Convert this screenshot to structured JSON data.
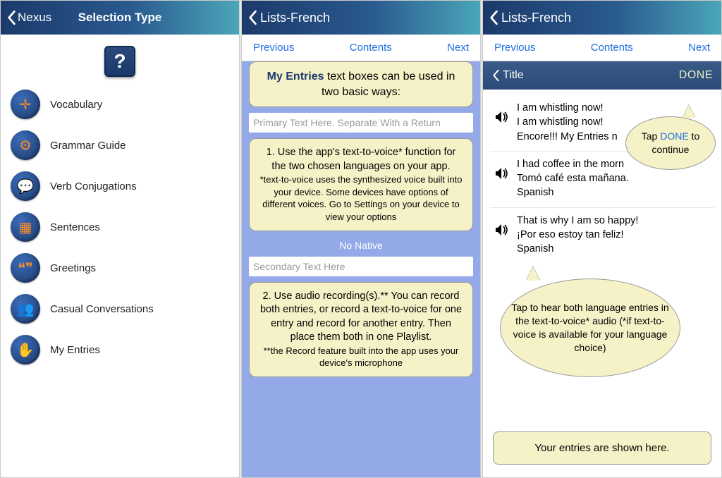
{
  "panel1": {
    "back_label": "Nexus",
    "title": "Selection Type",
    "help_label": "?",
    "items": [
      {
        "label": "Vocabulary",
        "icon": "puzzle-icon",
        "glyph": "✛"
      },
      {
        "label": "Grammar Guide",
        "icon": "gears-icon",
        "glyph": "⚙"
      },
      {
        "label": "Verb Conjugations",
        "icon": "speech-icon",
        "glyph": "💬"
      },
      {
        "label": "Sentences",
        "icon": "blocks-icon",
        "glyph": "▦"
      },
      {
        "label": "Greetings",
        "icon": "quotes-icon",
        "glyph": "❝❞"
      },
      {
        "label": "Casual Conversations",
        "icon": "people-icon",
        "glyph": "👥"
      },
      {
        "label": "My Entries",
        "icon": "hand-icon",
        "glyph": "✋"
      }
    ]
  },
  "panel2": {
    "back_label": "Lists-French",
    "subnav": {
      "prev": "Previous",
      "contents": "Contents",
      "next": "Next"
    },
    "top_card_bold": "My Entries",
    "top_card_rest": " text boxes can be used in two basic ways:",
    "input1_placeholder": "Primary Text Here. Separate With a Return",
    "card1_main": "1. Use the app's text-to-voice* function for the two chosen languages on your app.",
    "card1_fine": "*text-to-voice uses the synthesized voice built into your device. Some devices have options of different voices. Go to Settings on your device to view your options",
    "no_native": "No Native",
    "input2_placeholder": "Secondary Text Here",
    "card2_main": "2. Use audio recording(s).** You can record both entries, or record a text-to-voice for one entry and record for another entry. Then place them both in one Playlist.",
    "card2_fine": "**the Record feature built into the app uses your device's microphone"
  },
  "panel3": {
    "back_label": "Lists-French",
    "subnav": {
      "prev": "Previous",
      "contents": "Contents",
      "next": "Next"
    },
    "titlebar_back": "Title",
    "titlebar_done": "DONE",
    "entries": [
      {
        "l1": "I am whistling now!",
        "l2": "I am whistling now!",
        "l3": "Encore!!! My Entries n"
      },
      {
        "l1": "I had coffee in the morn",
        "l2": "Tomó café esta mañana.",
        "l3": "Spanish"
      },
      {
        "l1": "That is why I am so happy!",
        "l2": "¡Por eso estoy tan feliz!",
        "l3": "Spanish"
      }
    ],
    "bubble1_pre": "Tap ",
    "bubble1_done": "DONE",
    "bubble1_post": " to continue",
    "bubble2": "Tap to hear both language entries in the text-to-voice* audio (*if text-to-voice is available for your language choice)",
    "bottom_card": "Your entries are shown here."
  }
}
